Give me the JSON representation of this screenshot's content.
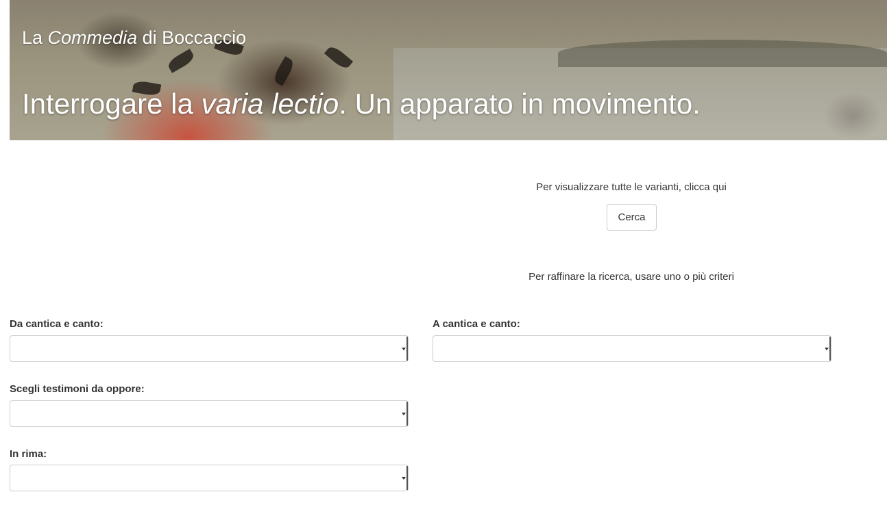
{
  "header": {
    "subtitle_pre": "La ",
    "subtitle_em": "Commedia",
    "subtitle_post": " di Boccaccio",
    "title_pre": "Interrogare la ",
    "title_em": "varia lectio",
    "title_post": ". Un apparato in movimento."
  },
  "search_all": {
    "instruction": "Per visualizzare tutte le varianti, clicca qui",
    "button_label": "Cerca"
  },
  "refine": {
    "instruction": "Per raffinare la ricerca, usare uno o più criteri"
  },
  "filters": {
    "from_canto": {
      "label": "Da cantica e canto:",
      "value": ""
    },
    "to_canto": {
      "label": "A cantica e canto:",
      "value": ""
    },
    "witnesses": {
      "label": "Scegli testimoni da oppore:",
      "value": ""
    },
    "rhyme": {
      "label": "In rima:",
      "value": ""
    }
  },
  "icons": {
    "dropdown": "chevron-down-icon",
    "banner": "banner-image"
  }
}
